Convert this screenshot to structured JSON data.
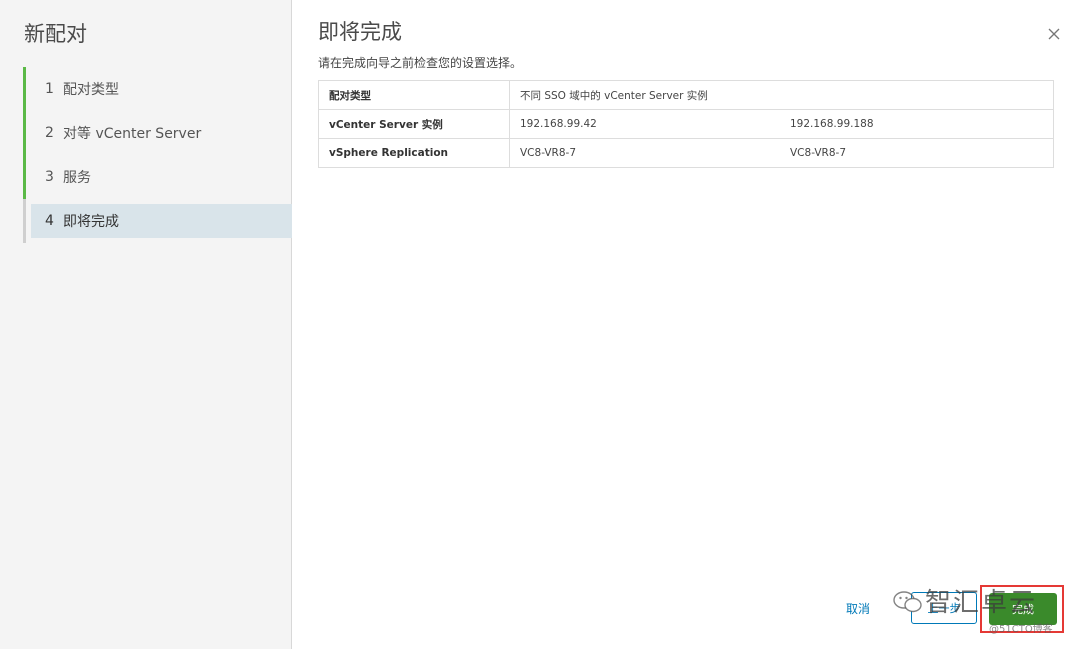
{
  "wizard": {
    "title": "新配对",
    "steps": [
      {
        "num": "1",
        "label": "配对类型"
      },
      {
        "num": "2",
        "label": "对等 vCenter Server"
      },
      {
        "num": "3",
        "label": "服务"
      },
      {
        "num": "4",
        "label": "即将完成"
      }
    ]
  },
  "content": {
    "title": "即将完成",
    "subtitle": "请在完成向导之前检查您的设置选择。",
    "rows": [
      {
        "key": "配对类型",
        "value": "不同 SSO 域中的 vCenter Server 实例"
      },
      {
        "key": "vCenter Server 实例",
        "value1": "192.168.99.42",
        "value2": "192.168.99.188"
      },
      {
        "key": "vSphere Replication",
        "value1": "VC8-VR8-7",
        "value2": "VC8-VR8-7"
      }
    ]
  },
  "footer": {
    "cancel_label": "取消",
    "back_label": "上一步",
    "finish_label": "完成"
  },
  "watermark": {
    "text": "智汇卓云",
    "sub": "@51CTO博客"
  },
  "icons": {
    "close": "close-icon",
    "wechat": "wechat-icon"
  },
  "colors": {
    "step_complete": "#5ab946",
    "current_step_bg": "#d9e4ea",
    "primary_button": "#3a8a2b",
    "link": "#0079b8",
    "highlight_box": "#e53935"
  }
}
